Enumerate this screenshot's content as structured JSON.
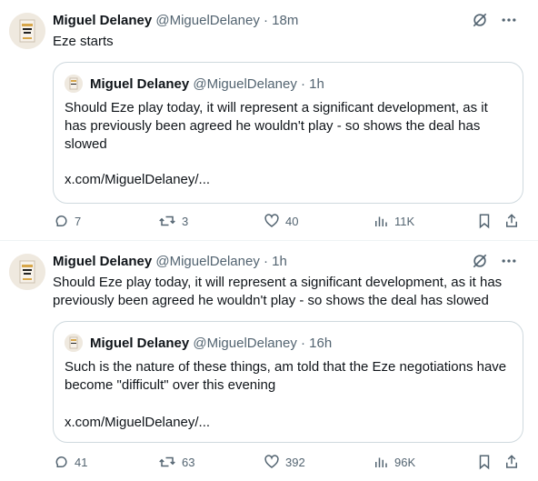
{
  "tweets": [
    {
      "name": "Miguel Delaney",
      "handle": "@MiguelDelaney",
      "sep": "·",
      "time": "18m",
      "text": "Eze starts",
      "quote": {
        "name": "Miguel Delaney",
        "handle": "@MiguelDelaney",
        "sep": "·",
        "time": "1h",
        "text": "Should Eze play today, it will represent a significant development, as it has previously been agreed he wouldn't play - so shows the deal has slowed",
        "link": "x.com/MiguelDelaney/..."
      },
      "stats": {
        "replies": "7",
        "reposts": "3",
        "likes": "40",
        "views": "11K"
      }
    },
    {
      "name": "Miguel Delaney",
      "handle": "@MiguelDelaney",
      "sep": "·",
      "time": "1h",
      "text": "Should Eze play today, it will represent a significant development, as it has previously been agreed he wouldn't play - so shows the deal has slowed",
      "quote": {
        "name": "Miguel Delaney",
        "handle": "@MiguelDelaney",
        "sep": "·",
        "time": "16h",
        "text": "Such is the nature of these things, am told that the Eze negotiations have become \"difficult\" over this evening",
        "link": "x.com/MiguelDelaney/..."
      },
      "stats": {
        "replies": "41",
        "reposts": "63",
        "likes": "392",
        "views": "96K"
      }
    }
  ],
  "icons": {
    "grok": "grok-icon",
    "more": "more-icon",
    "reply": "reply-icon",
    "repost": "repost-icon",
    "like": "like-icon",
    "views": "views-icon",
    "bookmark": "bookmark-icon",
    "share": "share-icon"
  },
  "colors": {
    "text": "#0f1419",
    "secondary": "#536471",
    "border": "#cfd9de"
  }
}
